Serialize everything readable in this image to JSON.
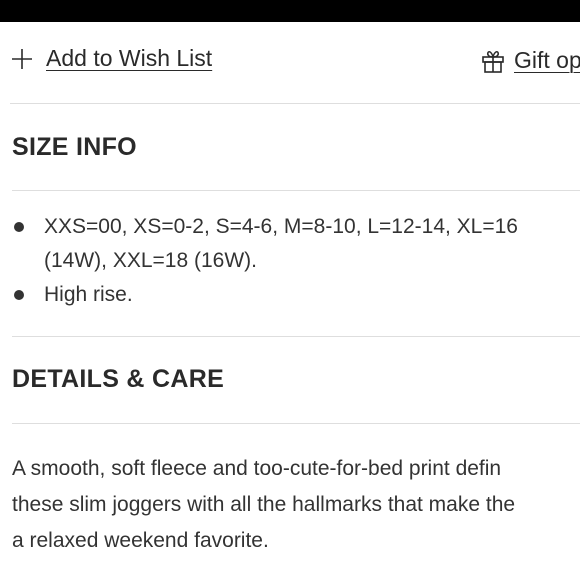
{
  "actions": {
    "wishlist_label": "Add to Wish List",
    "wishlist_icon": "plus-icon",
    "gift_label": "Gift op",
    "gift_icon": "gift-icon"
  },
  "size_info": {
    "title": "SIZE INFO",
    "bullets": [
      "XXS=00, XS=0-2, S=4-6, M=8-10, L=12-14, XL=16 (14W), XXL=18 (16W).",
      "High rise."
    ]
  },
  "details": {
    "title": "DETAILS & CARE",
    "description": "A smooth, soft fleece and too-cute-for-bed print defin\nthese slim joggers with all the hallmarks that make the\na relaxed weekend favorite."
  },
  "colors": {
    "topbar": "#000000",
    "text": "#2a2a2a",
    "divider": "#dedede"
  }
}
